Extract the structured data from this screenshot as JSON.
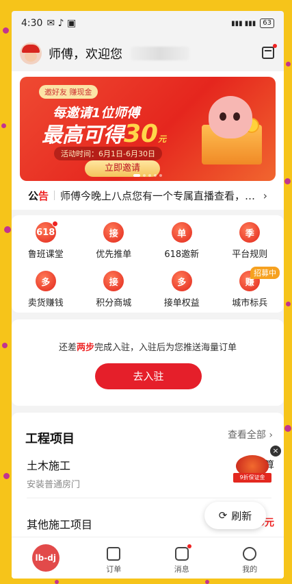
{
  "status_bar": {
    "time": "4:30",
    "battery": "63"
  },
  "header": {
    "greeting": "师傅，欢迎您"
  },
  "banner": {
    "tag": "邀好友 赚现金",
    "line1": "每邀请1位师傅",
    "line2_prefix": "最高可得",
    "amount": "30",
    "unit": "元",
    "time": "活动时间：6月1日-6月30日",
    "button": "立即邀请"
  },
  "notice": {
    "label_a": "公",
    "label_b": "告",
    "text": "师傅今晚上八点您有一个专属直播查看，…"
  },
  "grid": {
    "items": [
      {
        "icon": "618",
        "label": "鲁班课堂"
      },
      {
        "icon": "接",
        "label": "优先推单"
      },
      {
        "icon": "单",
        "label": "618邀新"
      },
      {
        "icon": "季",
        "label": "平台规则"
      },
      {
        "icon": "多",
        "label": "卖货赚钱"
      },
      {
        "icon": "接",
        "label": "积分商城"
      },
      {
        "icon": "多",
        "label": "接单权益"
      },
      {
        "icon": "赚",
        "label": "城市标兵"
      }
    ],
    "recruit_badge": "招募中"
  },
  "join": {
    "text_a": "还差",
    "text_hl": "两步",
    "text_b": "完成入驻，入驻后为您推送海量订单",
    "button": "去入驻"
  },
  "projects": {
    "title": "工程项目",
    "view_all": "查看全部",
    "items": [
      {
        "title": "土木施工",
        "sub": "安装普通房门",
        "budget_label": "预算",
        "budget_value": ""
      },
      {
        "title": "其他施工项目",
        "sub": "",
        "budget_label": "预算",
        "budget_value": "900元"
      }
    ]
  },
  "float_ad": {
    "ribbon": "9折保证金"
  },
  "refresh": {
    "label": "刷新"
  },
  "tabbar": {
    "home": "lb-dj",
    "orders": "订单",
    "messages": "消息",
    "me": "我的"
  }
}
